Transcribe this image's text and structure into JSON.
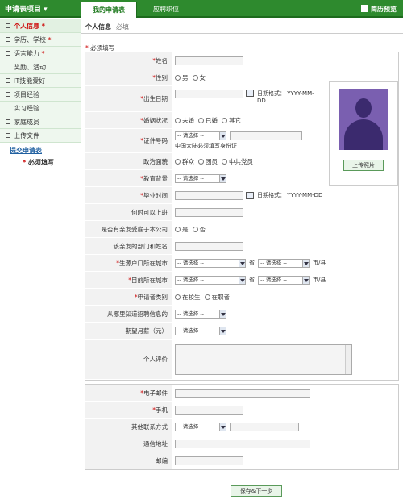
{
  "header": {
    "app_menu": "申请表项目",
    "tab_active": "我的申请表",
    "tab_other": "应聘职位",
    "resume_preview": "简历预览"
  },
  "sidebar": {
    "items": [
      {
        "label": "个人信息",
        "required": true,
        "active": true
      },
      {
        "label": "学历、学校",
        "required": true
      },
      {
        "label": "语言能力",
        "required": true
      },
      {
        "label": "奖励、活动"
      },
      {
        "label": "IT技能爱好"
      },
      {
        "label": "项目经验"
      },
      {
        "label": "实习经验"
      },
      {
        "label": "家庭成员"
      },
      {
        "label": "上传文件"
      }
    ],
    "submit_link": "提交申请表",
    "must_note": "必须填写"
  },
  "page": {
    "title": "个人信息",
    "title_sub": "必填",
    "req_note": "必须填写"
  },
  "form": {
    "name": "姓名",
    "gender": "性别",
    "male": "男",
    "female": "女",
    "birth": "出生日期",
    "date_format": "日期格式：  YYYY-MM-DD",
    "marital": "婚姻状况",
    "unmarried": "未婚",
    "married": "已婚",
    "other": "其它",
    "id_no": "证件号码",
    "select_placeholder": "-- 请选择 --",
    "id_hint": "中国大陆必须填写身份证",
    "political": "政治面貌",
    "masses": "群众",
    "league": "团员",
    "party": "中共党员",
    "education": "教育背景",
    "grad_time": "毕业时间",
    "start_work": "何时可以上班",
    "relative": "是否有亲友受雇于本公司",
    "yes": "是",
    "no": "否",
    "relative_dept": "该亲友的部门和姓名",
    "hukou_city": "生源户口所在城市",
    "current_city": "目前所在城市",
    "province": "省",
    "city": "市/县",
    "applicant_type": "申请者类别",
    "student": "在校生",
    "employed": "在职者",
    "channel": "从哪里知道招聘信息的",
    "salary": "期望月薪（元）",
    "self_eval": "个人评价",
    "upload_photo": "上传照片",
    "email": "电子邮件",
    "mobile": "手机",
    "other_contact": "其他联系方式",
    "address": "通信地址",
    "postcode": "邮编",
    "save_next": "保存&下一步"
  }
}
